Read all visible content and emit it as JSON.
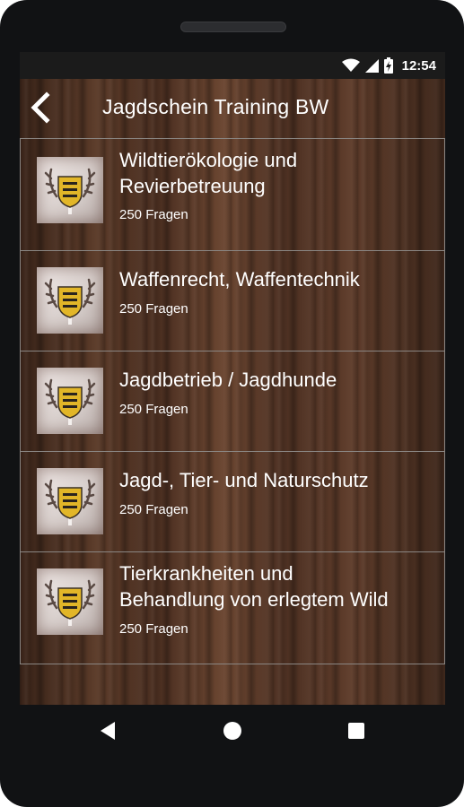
{
  "status": {
    "time": "12:54",
    "icons": [
      "wifi-icon",
      "signal-icon",
      "battery-icon"
    ]
  },
  "appbar": {
    "title": "Jagdschein Training BW",
    "back_icon": "back-arrow-icon"
  },
  "categories": [
    {
      "title": "Wildtierökologie und\nRevierbetreuung",
      "subtitle": "250 Fragen",
      "icon": "stag-crest-icon"
    },
    {
      "title": "Waffenrecht, Waffentechnik",
      "subtitle": "250 Fragen",
      "icon": "stag-crest-icon"
    },
    {
      "title": "Jagdbetrieb / Jagdhunde",
      "subtitle": "250 Fragen",
      "icon": "stag-crest-icon"
    },
    {
      "title": "Jagd-, Tier- und Naturschutz",
      "subtitle": "250 Fragen",
      "icon": "stag-crest-icon"
    },
    {
      "title": "Tierkrankheiten und\nBehandlung von erlegtem Wild",
      "subtitle": "250 Fragen",
      "icon": "stag-crest-icon"
    }
  ],
  "nav": {
    "icons": [
      "back-triangle-icon",
      "home-circle-icon",
      "recents-square-icon"
    ]
  },
  "colors": {
    "phone_frame": "#111214",
    "status_bar": "#1b1b1b",
    "row_border": "#8a8683",
    "text": "#ffffff",
    "crest_gold": "#e2b628"
  }
}
